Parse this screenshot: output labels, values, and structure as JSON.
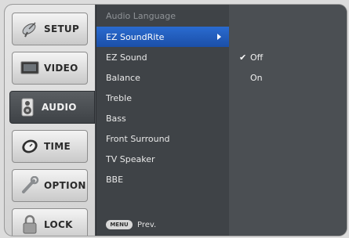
{
  "tabs": [
    {
      "label": "SETUP",
      "icon": "satellite-dish-icon"
    },
    {
      "label": "VIDEO",
      "icon": "monitor-icon"
    },
    {
      "label": "AUDIO",
      "icon": "speaker-icon",
      "active": true
    },
    {
      "label": "TIME",
      "icon": "clock-icon"
    },
    {
      "label": "OPTION",
      "icon": "wrench-icon"
    },
    {
      "label": "LOCK",
      "icon": "padlock-icon"
    }
  ],
  "menu": {
    "header": "Audio Language",
    "items": [
      {
        "label": "EZ SoundRite",
        "selected": true
      },
      {
        "label": "EZ Sound"
      },
      {
        "label": "Balance"
      },
      {
        "label": "Treble"
      },
      {
        "label": "Bass"
      },
      {
        "label": "Front Surround"
      },
      {
        "label": "TV Speaker"
      },
      {
        "label": "BBE"
      }
    ],
    "prev_key": "MENU",
    "prev_label": "Prev."
  },
  "submenu": {
    "items": [
      {
        "label": "Off",
        "checked": true,
        "check": "✔"
      },
      {
        "label": "On",
        "checked": false,
        "check": ""
      }
    ]
  },
  "colors": {
    "selection": "#2a6bd0",
    "panel": "#4a4e52",
    "tab_bg": "#dcdcdc"
  }
}
